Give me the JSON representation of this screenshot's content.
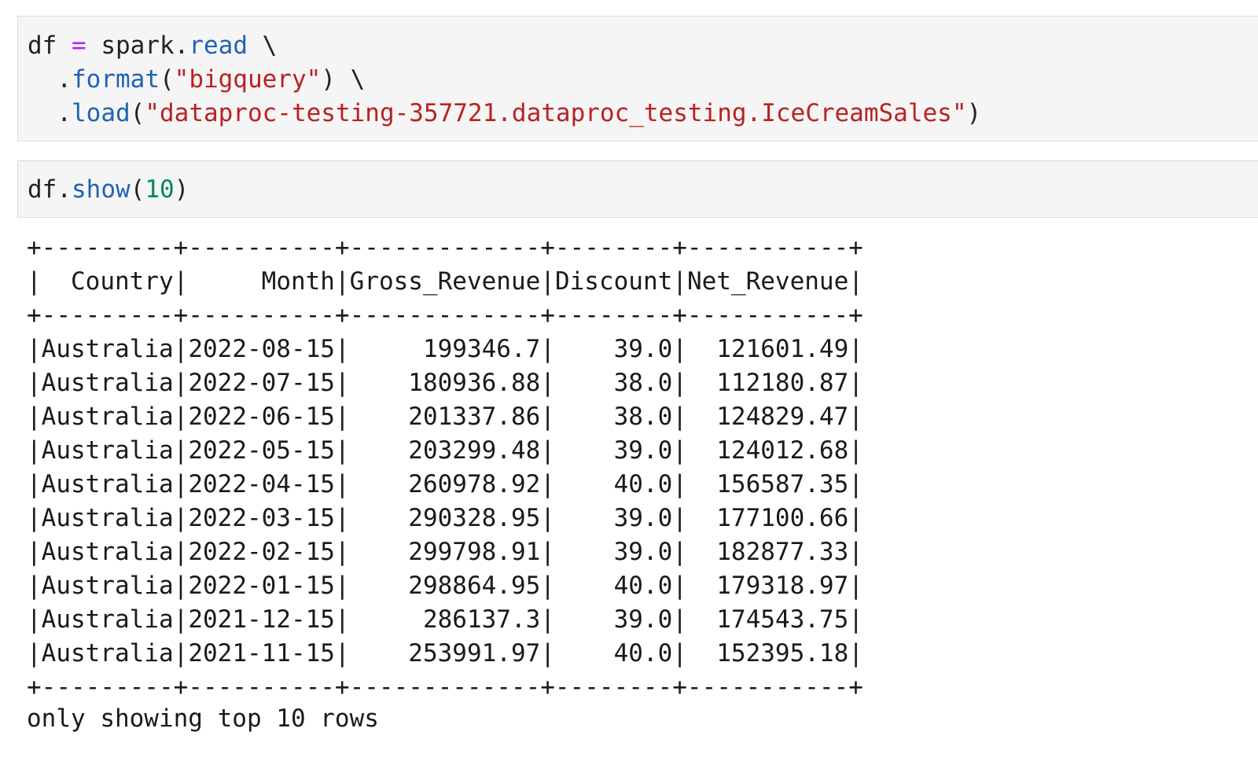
{
  "cells": [
    {
      "lines": [
        [
          {
            "cls": "",
            "text": "df "
          },
          {
            "cls": "op",
            "text": "="
          },
          {
            "cls": "",
            "text": " spark."
          },
          {
            "cls": "attr",
            "text": "read"
          },
          {
            "cls": "",
            "text": " \\"
          }
        ],
        [
          {
            "cls": "",
            "text": "  ."
          },
          {
            "cls": "attr",
            "text": "format"
          },
          {
            "cls": "",
            "text": "("
          },
          {
            "cls": "str",
            "text": "\"bigquery\""
          },
          {
            "cls": "",
            "text": ") \\"
          }
        ],
        [
          {
            "cls": "",
            "text": "  ."
          },
          {
            "cls": "attr",
            "text": "load"
          },
          {
            "cls": "",
            "text": "("
          },
          {
            "cls": "str",
            "text": "\"dataproc-testing-357721.dataproc_testing.IceCreamSales\""
          },
          {
            "cls": "",
            "text": ")"
          }
        ]
      ]
    },
    {
      "lines": [
        [
          {
            "cls": "",
            "text": "df."
          },
          {
            "cls": "attr",
            "text": "show"
          },
          {
            "cls": "",
            "text": "("
          },
          {
            "cls": "num",
            "text": "10"
          },
          {
            "cls": "",
            "text": ")"
          }
        ]
      ]
    }
  ],
  "table": {
    "columns": [
      "Country",
      "Month",
      "Gross_Revenue",
      "Discount",
      "Net_Revenue"
    ],
    "rows": [
      [
        "Australia",
        "2022-08-15",
        "199346.7",
        "39.0",
        "121601.49"
      ],
      [
        "Australia",
        "2022-07-15",
        "180936.88",
        "38.0",
        "112180.87"
      ],
      [
        "Australia",
        "2022-06-15",
        "201337.86",
        "38.0",
        "124829.47"
      ],
      [
        "Australia",
        "2022-05-15",
        "203299.48",
        "39.0",
        "124012.68"
      ],
      [
        "Australia",
        "2022-04-15",
        "260978.92",
        "40.0",
        "156587.35"
      ],
      [
        "Australia",
        "2022-03-15",
        "290328.95",
        "39.0",
        "177100.66"
      ],
      [
        "Australia",
        "2022-02-15",
        "299798.91",
        "39.0",
        "182877.33"
      ],
      [
        "Australia",
        "2022-01-15",
        "298864.95",
        "40.0",
        "179318.97"
      ],
      [
        "Australia",
        "2021-12-15",
        "286137.3",
        "39.0",
        "174543.75"
      ],
      [
        "Australia",
        "2021-11-15",
        "253991.97",
        "40.0",
        "152395.18"
      ]
    ]
  },
  "footer": "only showing top 10 rows"
}
